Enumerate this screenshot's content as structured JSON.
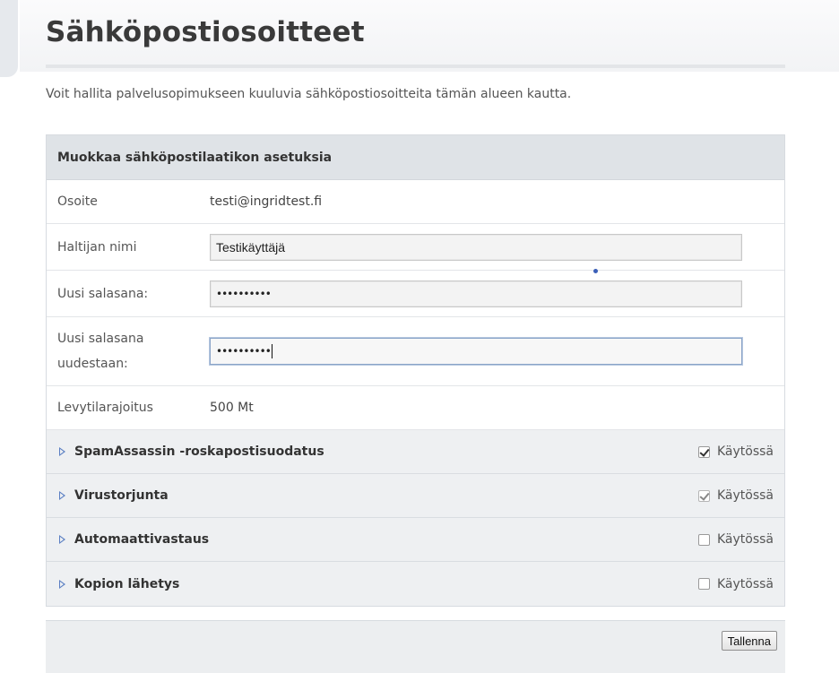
{
  "page": {
    "title": "Sähköpostiosoitteet",
    "intro": "Voit hallita palvelusopimukseen kuuluvia sähköpostiosoitteita tämän alueen kautta."
  },
  "panel": {
    "header": "Muokkaa sähköpostilaatikon asetuksia",
    "fields": {
      "address_label": "Osoite",
      "address_value": "testi@ingridtest.fi",
      "owner_label": "Haltijan nimi",
      "owner_value": "Testikäyttäjä",
      "password_label": "Uusi salasana:",
      "password_value": "••••••••••",
      "password_repeat_label": "Uusi salasana uudestaan:",
      "password_repeat_value": "••••••••••",
      "quota_label": "Levytilarajoitus",
      "quota_value": "500 Mt"
    },
    "sections": [
      {
        "title": "SpamAssassin -roskapostisuodatus",
        "enabled_label": "Käytössä",
        "checked": true
      },
      {
        "title": "Virustorjunta",
        "enabled_label": "Käytössä",
        "checked": true
      },
      {
        "title": "Automaattivastaus",
        "enabled_label": "Käytössä",
        "checked": false
      },
      {
        "title": "Kopion lähetys",
        "enabled_label": "Käytössä",
        "checked": false
      }
    ]
  },
  "footer": {
    "save_label": "Tallenna"
  },
  "colors": {
    "accent": "#5b7fc3",
    "panel_header_bg": "#dfe3e7",
    "section_bg": "#eef0f2"
  }
}
